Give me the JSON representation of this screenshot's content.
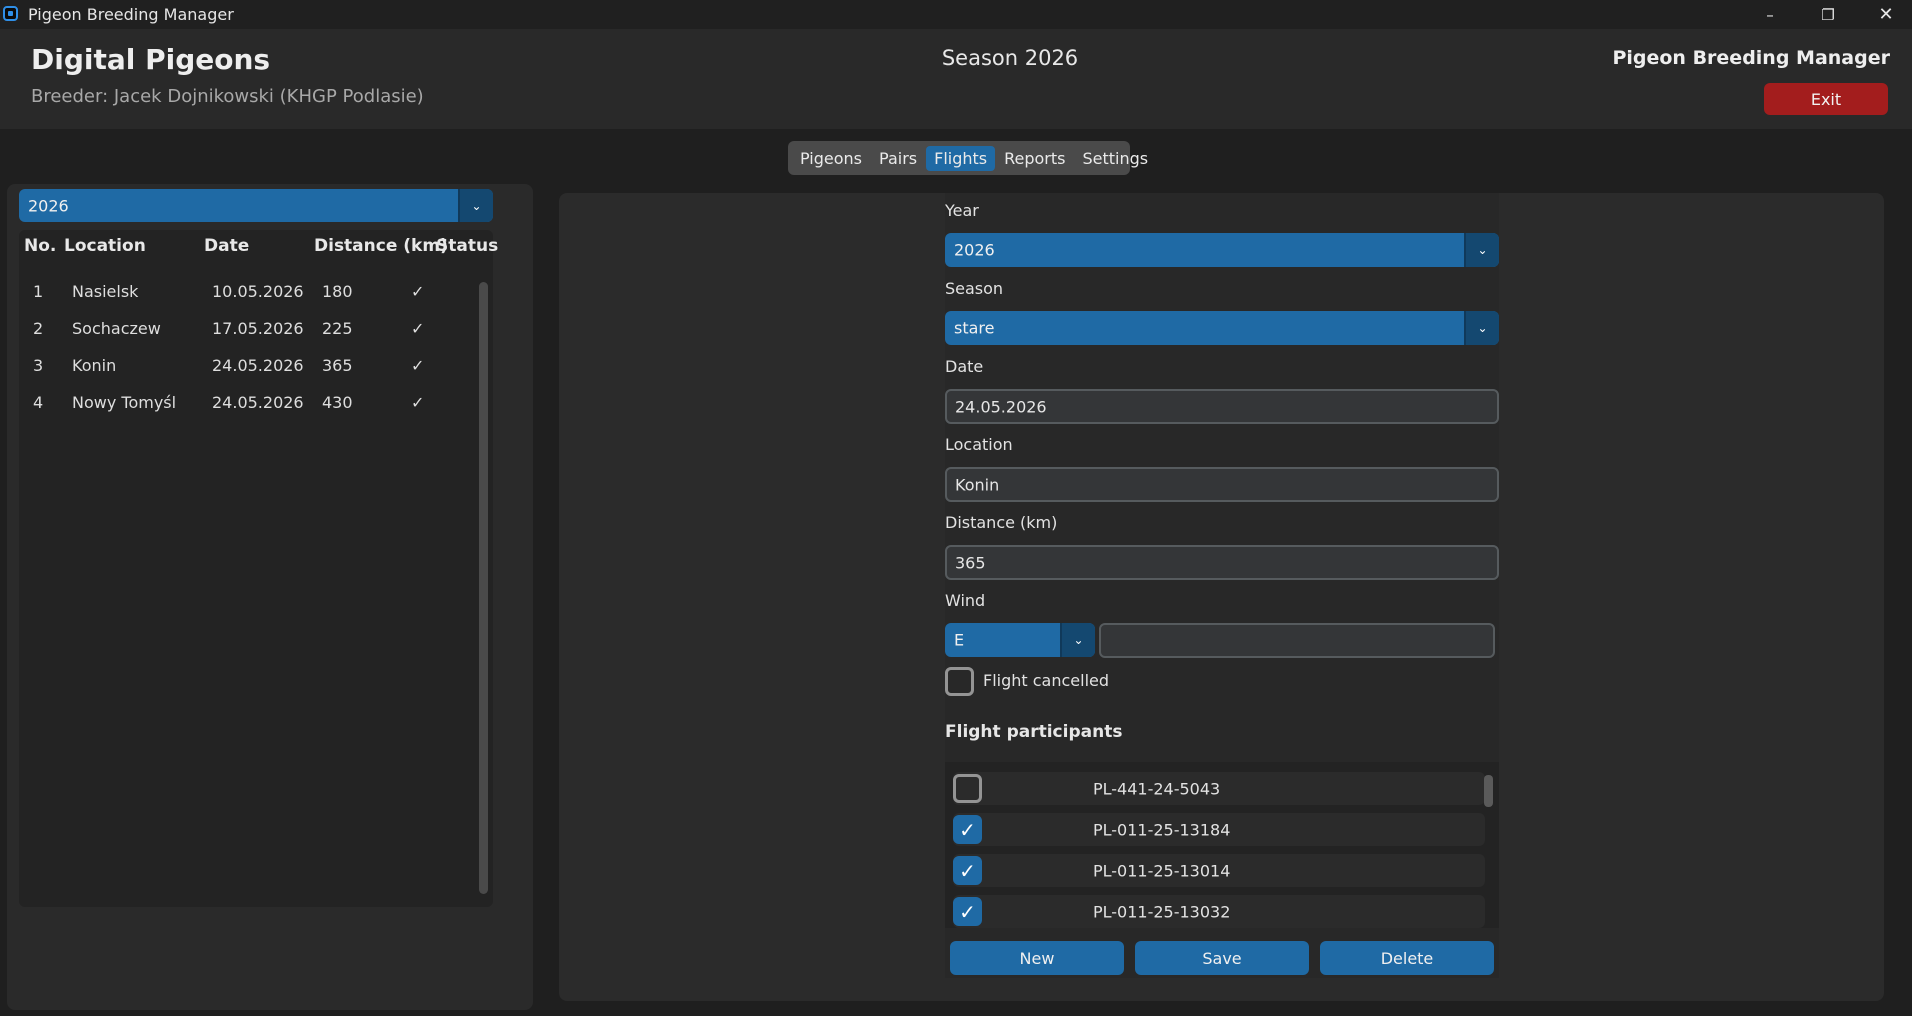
{
  "window": {
    "title": "Pigeon Breeding Manager"
  },
  "header": {
    "app_name": "Digital Pigeons",
    "breeder": "Breeder: Jacek Dojnikowski (KHGP Podlasie)",
    "season": "Season 2026",
    "brand": "Pigeon Breeding Manager",
    "exit_label": "Exit"
  },
  "tabs": [
    {
      "label": "Pigeons",
      "active": false
    },
    {
      "label": "Pairs",
      "active": false
    },
    {
      "label": "Flights",
      "active": true
    },
    {
      "label": "Reports",
      "active": false
    },
    {
      "label": "Settings",
      "active": false
    }
  ],
  "flights_list": {
    "year_filter": "2026",
    "columns": [
      "No.",
      "Location",
      "Date",
      "Distance (km)",
      "Status"
    ],
    "rows": [
      {
        "no": "1",
        "location": "Nasielsk",
        "date": "10.05.2026",
        "distance": "180",
        "status": "✓"
      },
      {
        "no": "2",
        "location": "Sochaczew",
        "date": "17.05.2026",
        "distance": "225",
        "status": "✓"
      },
      {
        "no": "3",
        "location": "Konin",
        "date": "24.05.2026",
        "distance": "365",
        "status": "✓"
      },
      {
        "no": "4",
        "location": "Nowy Tomyśl",
        "date": "24.05.2026",
        "distance": "430",
        "status": "✓"
      }
    ]
  },
  "form": {
    "year_label": "Year",
    "year_value": "2026",
    "season_label": "Season",
    "season_value": "stare",
    "date_label": "Date",
    "date_value": "24.05.2026",
    "location_label": "Location",
    "location_value": "Konin",
    "distance_label": "Distance (km)",
    "distance_value": "365",
    "wind_label": "Wind",
    "wind_value": "E",
    "wind_extra": "",
    "cancelled_label": "Flight cancelled",
    "cancelled_checked": false,
    "participants_title": "Flight participants",
    "participants": [
      {
        "ring": "PL-441-24-5043",
        "checked": false
      },
      {
        "ring": "PL-011-25-13184",
        "checked": true
      },
      {
        "ring": "PL-011-25-13014",
        "checked": true
      },
      {
        "ring": "PL-011-25-13032",
        "checked": true
      }
    ],
    "buttons": {
      "new": "New",
      "save": "Save",
      "delete": "Delete"
    }
  },
  "colors": {
    "accent": "#1f6aa5",
    "exit": "#a31d1d"
  },
  "icons": {
    "dropdown": "chevron-down-icon",
    "check": "check-icon",
    "minimize": "minimize-icon",
    "restore": "restore-icon",
    "close": "close-icon"
  }
}
